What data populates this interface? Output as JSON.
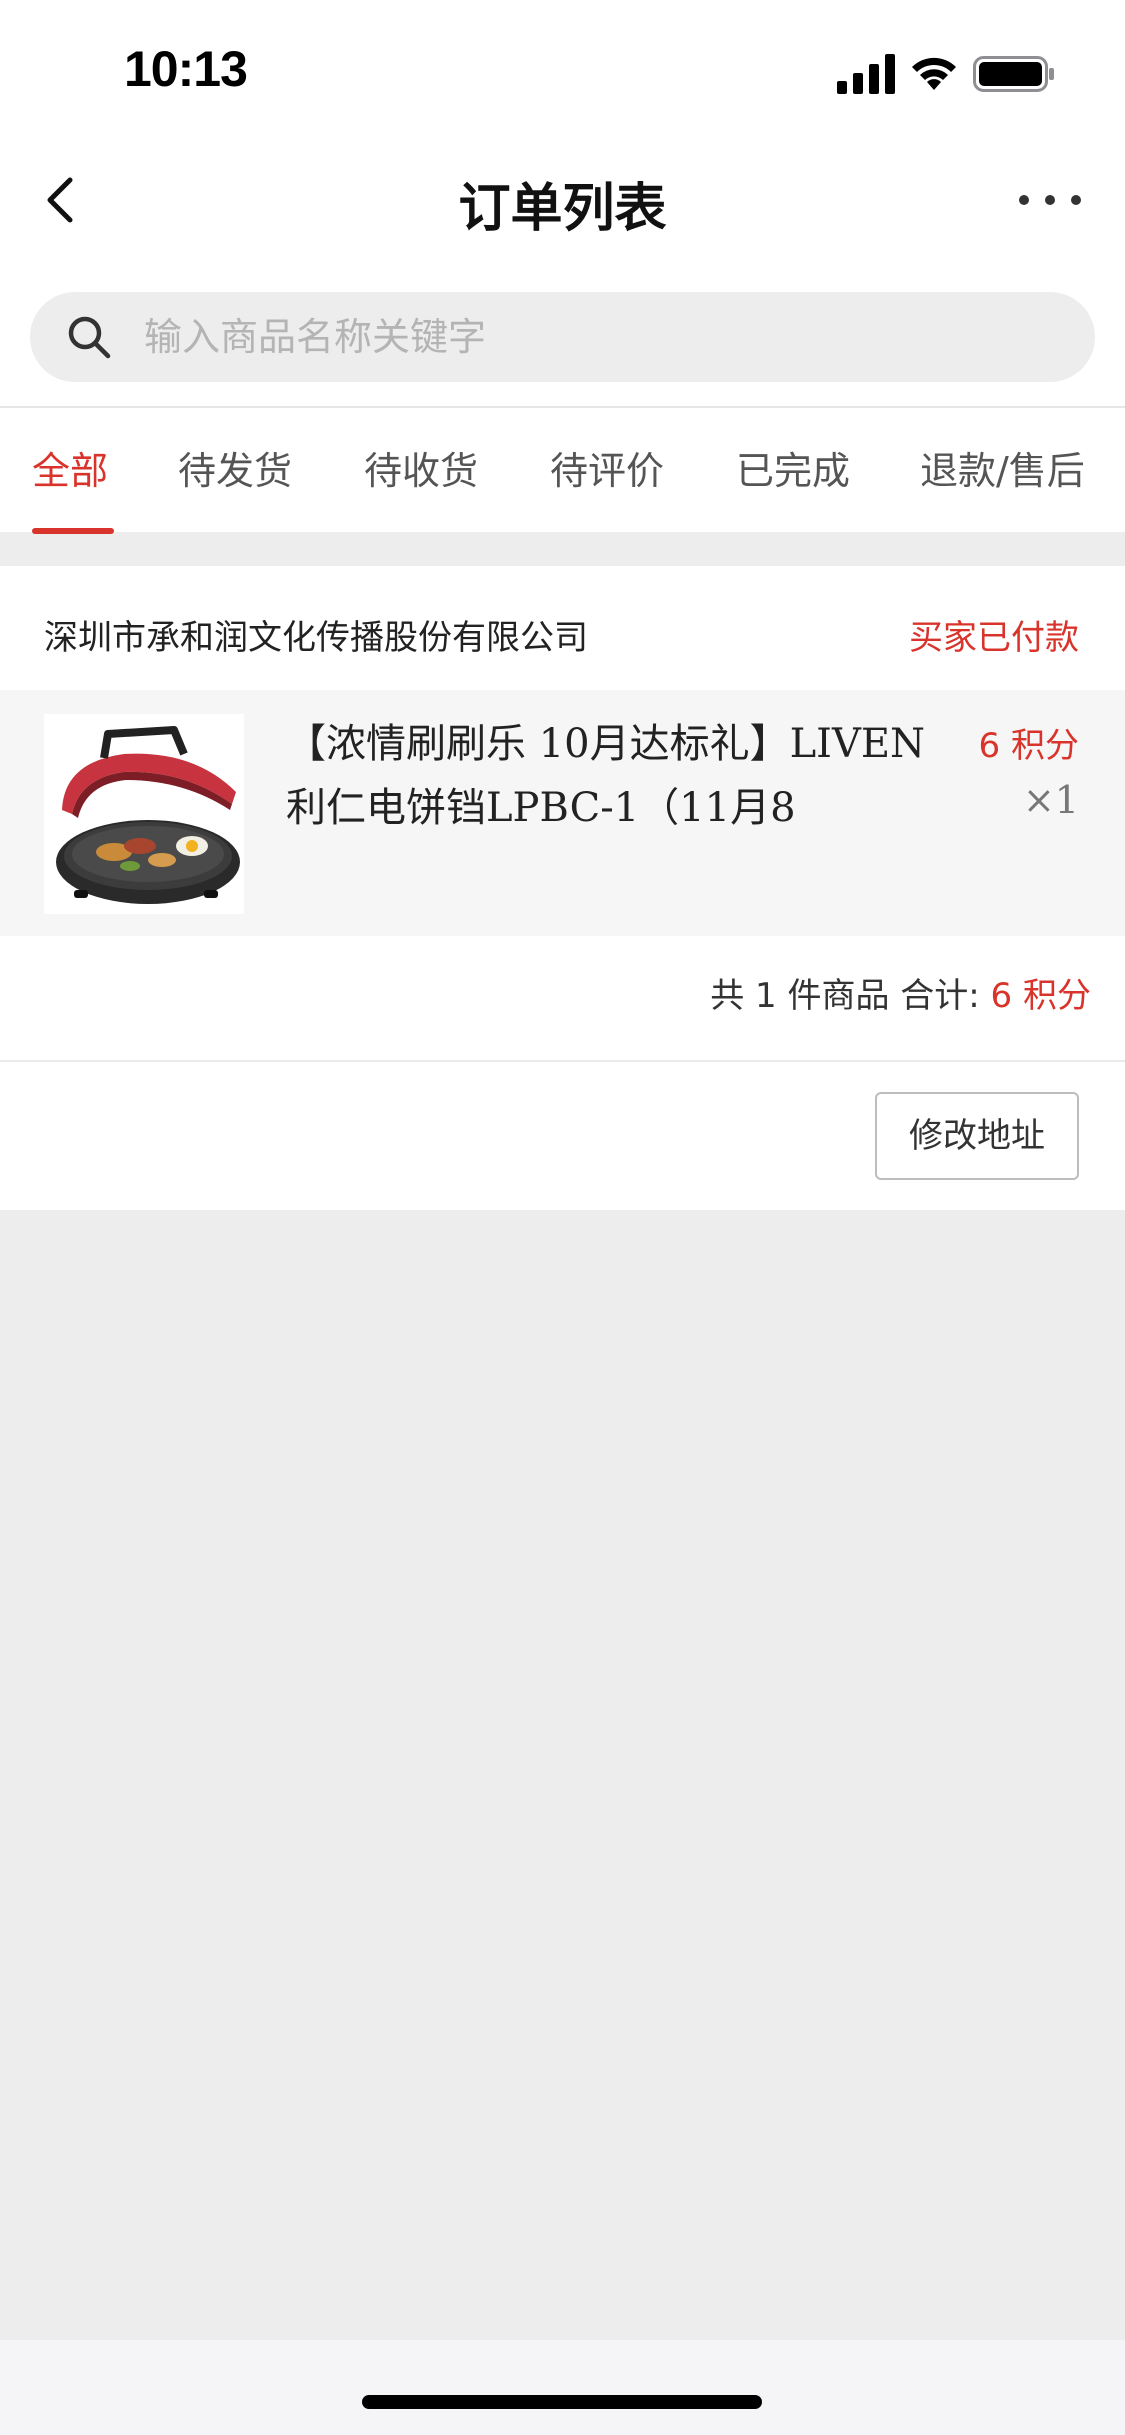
{
  "status_bar": {
    "time": "10:13"
  },
  "nav": {
    "title": "订单列表"
  },
  "search": {
    "placeholder": "输入商品名称关键字",
    "value": ""
  },
  "tabs": [
    {
      "label": "全部",
      "active": true
    },
    {
      "label": "待发货",
      "active": false
    },
    {
      "label": "待收货",
      "active": false
    },
    {
      "label": "待评价",
      "active": false
    },
    {
      "label": "已完成",
      "active": false
    },
    {
      "label": "退款/售后",
      "active": false
    }
  ],
  "order": {
    "shop_name": "深圳市承和润文化传播股份有限公司",
    "status": "买家已付款",
    "item": {
      "title": "【浓情刷刷乐 10月达标礼】LIVEN利仁电饼铛LPBC-1（11月8",
      "points": "6 积分",
      "quantity": "×1"
    },
    "summary_count": "共 1 件商品 合计:",
    "summary_total": "6 积分",
    "modify_button": "修改地址"
  },
  "colors": {
    "accent": "#d9342b",
    "page_bg": "#ededed"
  }
}
